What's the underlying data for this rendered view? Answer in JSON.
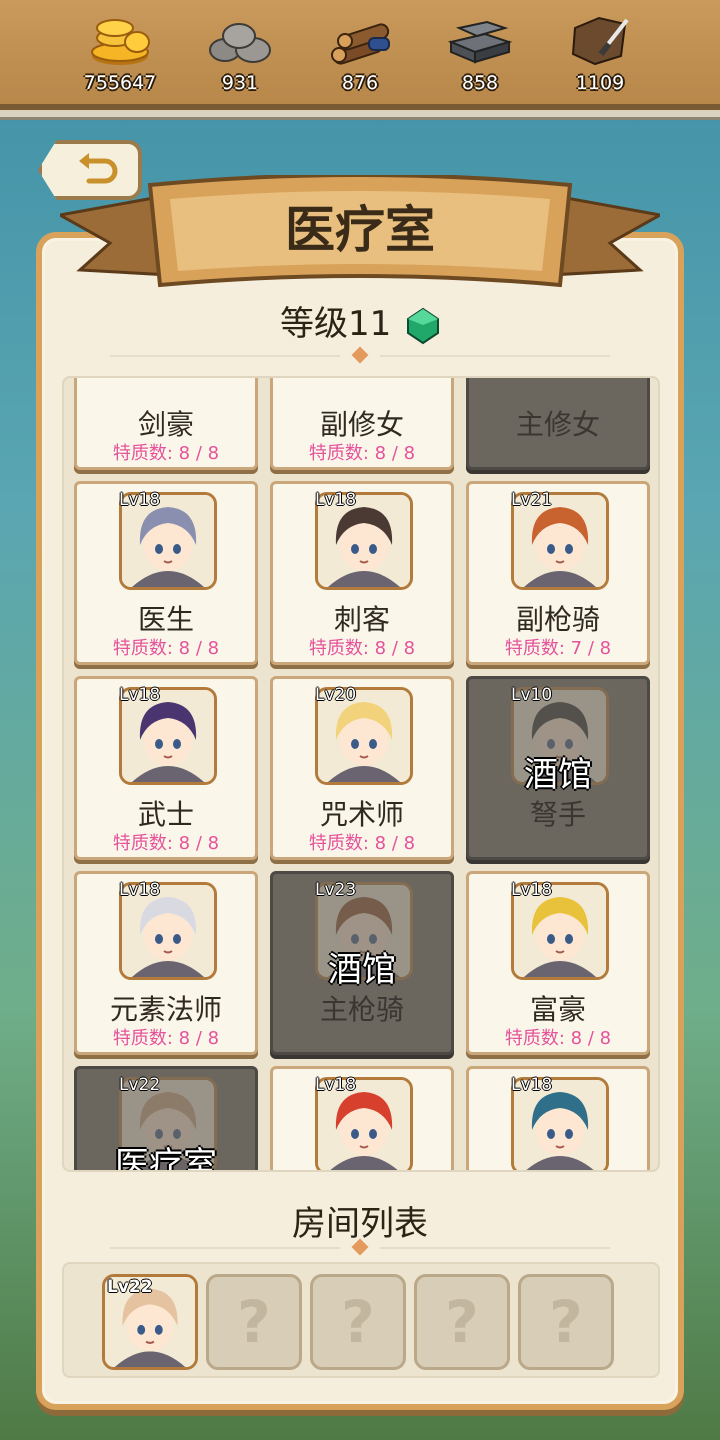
{
  "resources": [
    {
      "icon": "gold-coins-icon",
      "value": "755647"
    },
    {
      "icon": "stone-icon",
      "value": "931"
    },
    {
      "icon": "wood-logs-icon",
      "value": "876"
    },
    {
      "icon": "iron-ingot-icon",
      "value": "858"
    },
    {
      "icon": "leather-icon",
      "value": "1109"
    }
  ],
  "title": "医疗室",
  "level_label": "等级11",
  "heroes": [
    {
      "name": "剑豪",
      "trait": "特质数: 8 / 8",
      "lv": "",
      "locked": false
    },
    {
      "name": "副修女",
      "trait": "特质数: 8 / 8",
      "lv": "",
      "locked": false
    },
    {
      "name": "主修女",
      "trait": "",
      "lv": "",
      "locked": true,
      "lock_label": ""
    },
    {
      "name": "医生",
      "trait": "特质数: 8 / 8",
      "lv": "Lv18",
      "locked": false,
      "hair": "#8a8fb0"
    },
    {
      "name": "刺客",
      "trait": "特质数: 8 / 8",
      "lv": "Lv18",
      "locked": false,
      "hair": "#4a3a33"
    },
    {
      "name": "副枪骑",
      "trait": "特质数: 7 / 8",
      "lv": "Lv21",
      "locked": false,
      "hair": "#c8622f"
    },
    {
      "name": "武士",
      "trait": "特质数: 8 / 8",
      "lv": "Lv18",
      "locked": false,
      "hair": "#4a3570"
    },
    {
      "name": "咒术师",
      "trait": "特质数: 8 / 8",
      "lv": "Lv20",
      "locked": false,
      "hair": "#f2d27a"
    },
    {
      "name": "弩手",
      "trait": "",
      "lv": "Lv10",
      "locked": true,
      "lock_label": "酒馆",
      "hair": "#2b2b2b"
    },
    {
      "name": "元素法师",
      "trait": "特质数: 8 / 8",
      "lv": "Lv18",
      "locked": false,
      "hair": "#d9d9e2"
    },
    {
      "name": "主枪骑",
      "trait": "",
      "lv": "Lv23",
      "locked": true,
      "lock_label": "酒馆",
      "hair": "#8a4a2a"
    },
    {
      "name": "富豪",
      "trait": "特质数: 8 / 8",
      "lv": "Lv18",
      "locked": false,
      "hair": "#e8c23a"
    },
    {
      "name": "",
      "trait": "",
      "lv": "Lv22",
      "locked": true,
      "lock_label": "医疗室",
      "hair": "#c9a47e"
    },
    {
      "name": "",
      "trait": "",
      "lv": "Lv18",
      "locked": false,
      "hair": "#d8402e"
    },
    {
      "name": "",
      "trait": "",
      "lv": "Lv18",
      "locked": false,
      "hair": "#2f6f8a"
    }
  ],
  "rooms_title": "房间列表",
  "room_slots": [
    {
      "filled": true,
      "lv": "Lv22",
      "hair": "#e6c3a0"
    },
    {
      "filled": false,
      "placeholder": "?"
    },
    {
      "filled": false,
      "placeholder": "?"
    },
    {
      "filled": false,
      "placeholder": "?"
    },
    {
      "filled": false,
      "placeholder": "?"
    }
  ]
}
